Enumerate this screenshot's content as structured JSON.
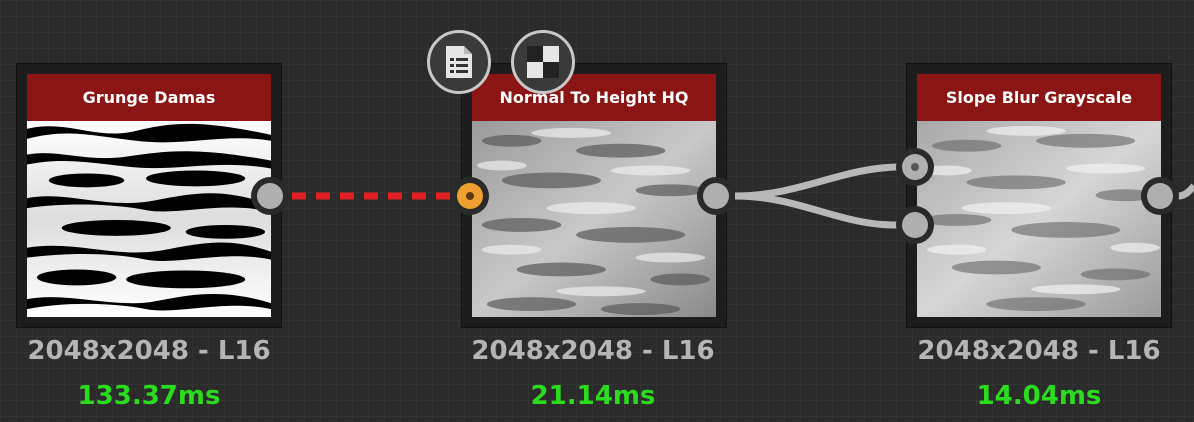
{
  "nodes": [
    {
      "title": "Grunge Damas",
      "resolution": "2048x2048 - L16",
      "timing": "133.37ms"
    },
    {
      "title": "Normal To Height HQ",
      "resolution": "2048x2048 - L16",
      "timing": "21.14ms"
    },
    {
      "title": "Slope Blur Grayscale",
      "resolution": "2048x2048 - L16",
      "timing": "14.04ms"
    }
  ],
  "toolbar": {
    "icons": [
      "document-list-icon",
      "checker-preview-icon"
    ]
  },
  "colors": {
    "title_bar": "#8b1414",
    "timing_text": "#2bdc1e",
    "dashed_link": "#e02020",
    "active_port": "#f0a030"
  }
}
